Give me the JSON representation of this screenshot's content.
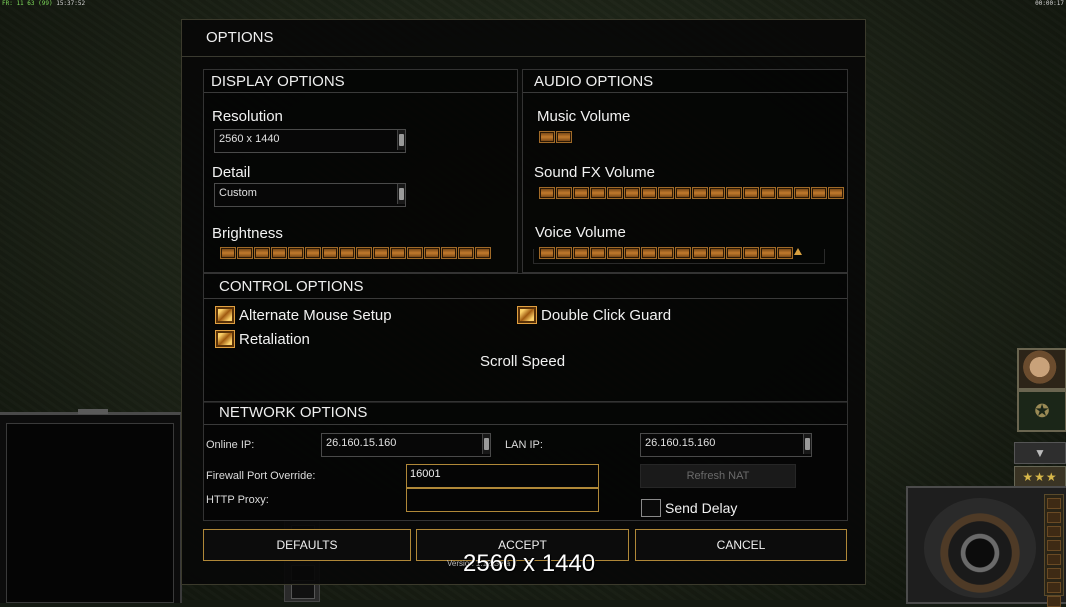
{
  "hud": {
    "left_fps": "FR: 11 63 (99)",
    "left_time": "15:37:52",
    "right_time": "00:00:17"
  },
  "dialog": {
    "title": "OPTIONS",
    "display": {
      "header": "DISPLAY OPTIONS",
      "resolution_label": "Resolution",
      "resolution_value": "2560 x 1440",
      "detail_label": "Detail",
      "detail_value": "Custom",
      "brightness_label": "Brightness",
      "brightness_level": 1.0
    },
    "audio": {
      "header": "AUDIO OPTIONS",
      "music_label": "Music Volume",
      "music_level": 0.11,
      "sfx_label": "Sound FX Volume",
      "sfx_level": 1.0,
      "voice_label": "Voice Volume",
      "voice_level": 0.85
    },
    "control": {
      "header": "CONTROL OPTIONS",
      "alt_mouse_label": "Alternate Mouse Setup",
      "alt_mouse_checked": true,
      "double_click_label": "Double Click Guard",
      "double_click_checked": true,
      "retaliation_label": "Retaliation",
      "retaliation_checked": true,
      "scroll_speed_label": "Scroll Speed"
    },
    "network": {
      "header": "NETWORK OPTIONS",
      "online_ip_label": "Online IP:",
      "online_ip_value": "26.160.15.160",
      "lan_ip_label": "LAN IP:",
      "lan_ip_value": "26.160.15.160",
      "firewall_label": "Firewall Port Override:",
      "firewall_value": "16001",
      "proxy_label": "HTTP Proxy:",
      "proxy_value": "",
      "refresh_nat_label": "Refresh NAT",
      "send_delay_label": "Send Delay",
      "send_delay_checked": false
    },
    "buttons": {
      "defaults": "DEFAULTS",
      "accept": "ACCEPT",
      "cancel": "CANCEL"
    },
    "version_text": "Version 1.12 Beta 2",
    "resolution_overlay": "2560 x 1440"
  },
  "side_hud": {
    "rank_stars": "★★★",
    "down_arrow": "▼"
  },
  "colors": {
    "accent": "#b08838",
    "slider_orange": "#c27a2c",
    "dialog_bg": "#080808"
  }
}
